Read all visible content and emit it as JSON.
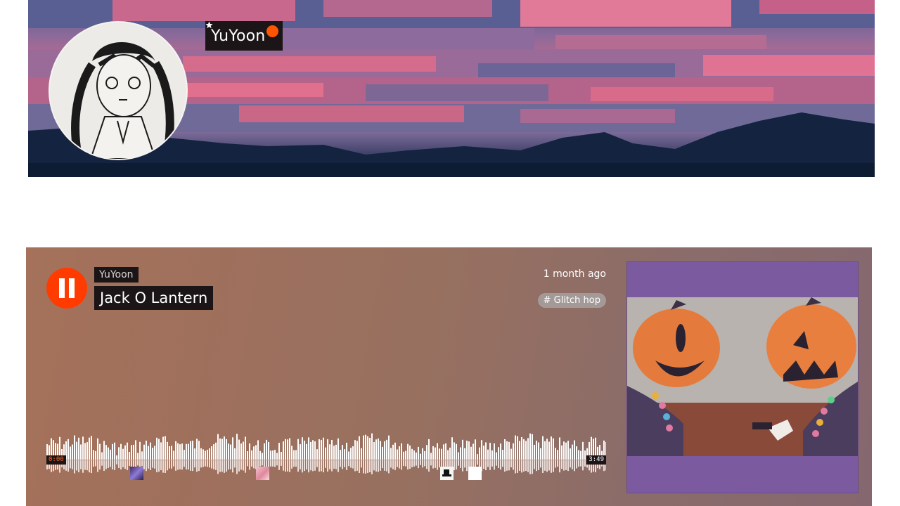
{
  "profile": {
    "username": "YuYoon",
    "badge_icon": "pro-star-icon",
    "accent": "#ff5500"
  },
  "track": {
    "artist": "YuYoon",
    "title": "Jack O Lantern",
    "posted": "1 month ago",
    "genre": "# Glitch hop",
    "time_current": "0:00",
    "time_total": "3:49",
    "progress": 0,
    "play_state_icon": "pause-icon",
    "accent": "#ff3b00"
  }
}
